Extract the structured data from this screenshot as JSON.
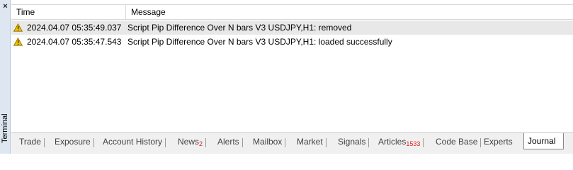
{
  "sidebar": {
    "close_glyph": "×",
    "title": "Terminal"
  },
  "table": {
    "columns": {
      "time": "Time",
      "message": "Message"
    },
    "rows": [
      {
        "icon": "warning-icon",
        "time": "2024.04.07 05:35:49.037",
        "message": "Script Pip Difference Over N bars V3 USDJPY,H1: removed"
      },
      {
        "icon": "warning-icon",
        "time": "2024.04.07 05:35:47.543",
        "message": "Script Pip Difference Over N bars V3 USDJPY,H1: loaded successfully"
      }
    ]
  },
  "tabs": [
    {
      "label": "Trade"
    },
    {
      "label": "Exposure"
    },
    {
      "label": "Account History"
    },
    {
      "label": "News",
      "badge": "2"
    },
    {
      "label": "Alerts"
    },
    {
      "label": "Mailbox"
    },
    {
      "label": "Market"
    },
    {
      "label": "Signals"
    },
    {
      "label": "Articles",
      "badge": "1533"
    },
    {
      "label": "Code Base"
    },
    {
      "label": "Experts"
    },
    {
      "label": "Journal",
      "active": true
    }
  ],
  "colors": {
    "badge": "#e02020",
    "warning": "#f2c200",
    "selected_row": "#e8e8e8",
    "sidebar": "#dde6f1"
  }
}
